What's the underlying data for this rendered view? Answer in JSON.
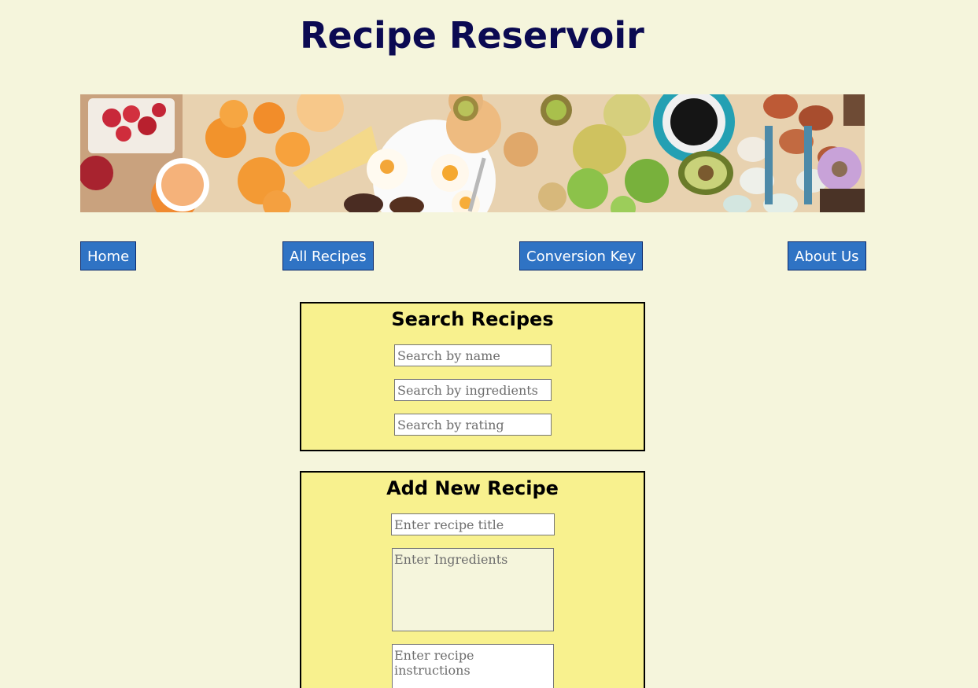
{
  "header": {
    "title": "Recipe Reservoir"
  },
  "nav": {
    "home": "Home",
    "all_recipes": "All Recipes",
    "conversion_key": "Conversion Key",
    "about_us": "About Us"
  },
  "search_panel": {
    "title": "Search Recipes",
    "name_placeholder": "Search by name",
    "ingredients_placeholder": "Search by ingredients",
    "rating_placeholder": "Search by rating"
  },
  "add_panel": {
    "title": "Add New Recipe",
    "title_placeholder": "Enter recipe title",
    "ingredients_placeholder": "Enter Ingredients",
    "instructions_placeholder": "Enter recipe instructions"
  },
  "colors": {
    "page_bg": "#f5f5dc",
    "title": "#0b0a52",
    "nav_button": "#2f73c4",
    "panel_bg": "#f8f18e"
  }
}
